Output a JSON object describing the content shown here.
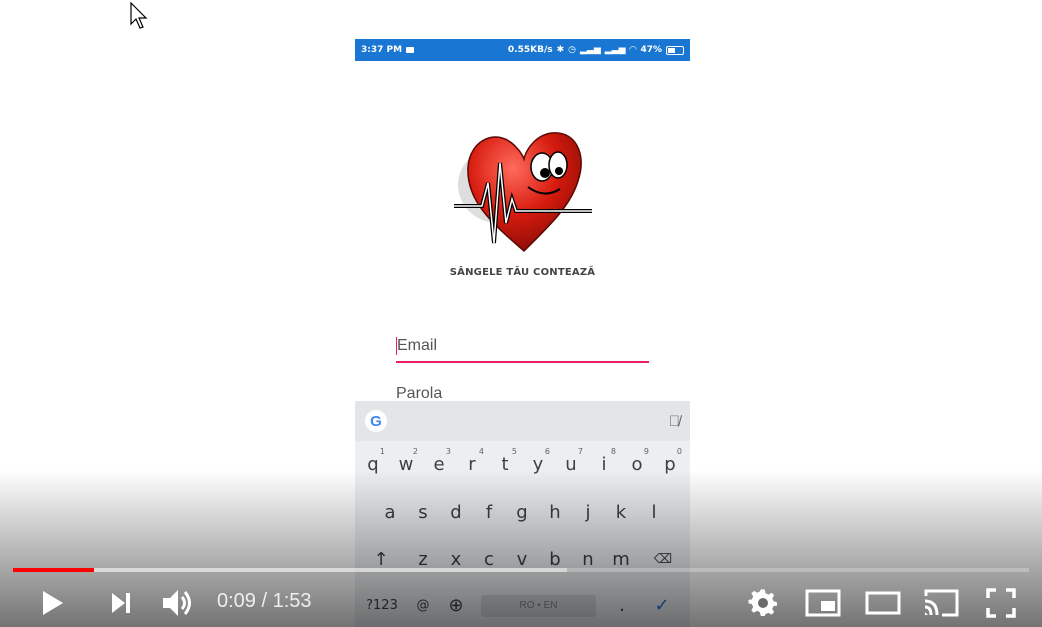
{
  "phone": {
    "status": {
      "time": "3:37 PM",
      "speed": "0.55KB/s",
      "battery": "47%"
    },
    "app": {
      "logo_text": "SÂNGELE TĂU CONTEAZĂ"
    },
    "form": {
      "email_placeholder": "Email",
      "password_placeholder": "Parola"
    },
    "keyboard": {
      "row1": [
        "q",
        "w",
        "e",
        "r",
        "t",
        "y",
        "u",
        "i",
        "o",
        "p"
      ],
      "row1_hints": [
        "1",
        "2",
        "3",
        "4",
        "5",
        "6",
        "7",
        "8",
        "9",
        "0"
      ],
      "row2": [
        "a",
        "s",
        "d",
        "f",
        "g",
        "h",
        "j",
        "k",
        "l"
      ],
      "row3": [
        "z",
        "x",
        "c",
        "v",
        "b",
        "n",
        "m"
      ],
      "symbols_key": "?123",
      "at_key": "@",
      "space_label": "RO • EN",
      "period_key": "."
    }
  },
  "player": {
    "current_time": "0:09",
    "duration": "1:53",
    "time_display": "0:09 / 1:53",
    "played_fraction": 0.08,
    "loaded_fraction": 0.545,
    "icons": [
      "play-icon",
      "next-icon",
      "volume-icon",
      "settings-icon",
      "miniplayer-icon",
      "theater-icon",
      "cast-icon",
      "fullscreen-icon"
    ],
    "accent_color": "#ff0000"
  }
}
